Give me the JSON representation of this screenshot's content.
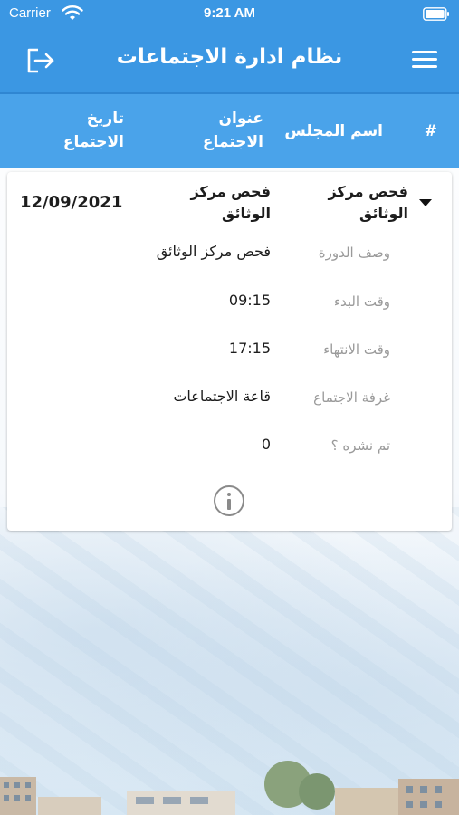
{
  "status_bar": {
    "carrier": "Carrier",
    "time": "9:21 AM"
  },
  "app_bar": {
    "title": "نظام ادارة الاجتماعات",
    "logout_icon": "logout-icon",
    "menu_icon": "hamburger-menu-icon"
  },
  "table": {
    "headers": {
      "hash": "#",
      "council_name": "اسم المجلس",
      "meeting_title": "عنوان الاجتماع",
      "meeting_date": "تاريخ الاجتماع"
    },
    "rows": [
      {
        "council_name": "فحص مركز الوثائق",
        "meeting_title": "فحص مركز الوثائق",
        "meeting_date": "12/09/2021",
        "details": [
          {
            "label": "وصف الدورة",
            "value": "فحص مركز الوثائق"
          },
          {
            "label": "وقت البدء",
            "value": "09:15"
          },
          {
            "label": "وقت الانتهاء",
            "value": "17:15"
          },
          {
            "label": "غرفة الاجتماع",
            "value": "قاعة الاجتماعات"
          },
          {
            "label": "تم نشره ؟",
            "value": "0"
          }
        ]
      }
    ]
  },
  "colors": {
    "primary": "#3b97e3",
    "header": "#4aa3ea",
    "label": "#9a9a9a"
  }
}
